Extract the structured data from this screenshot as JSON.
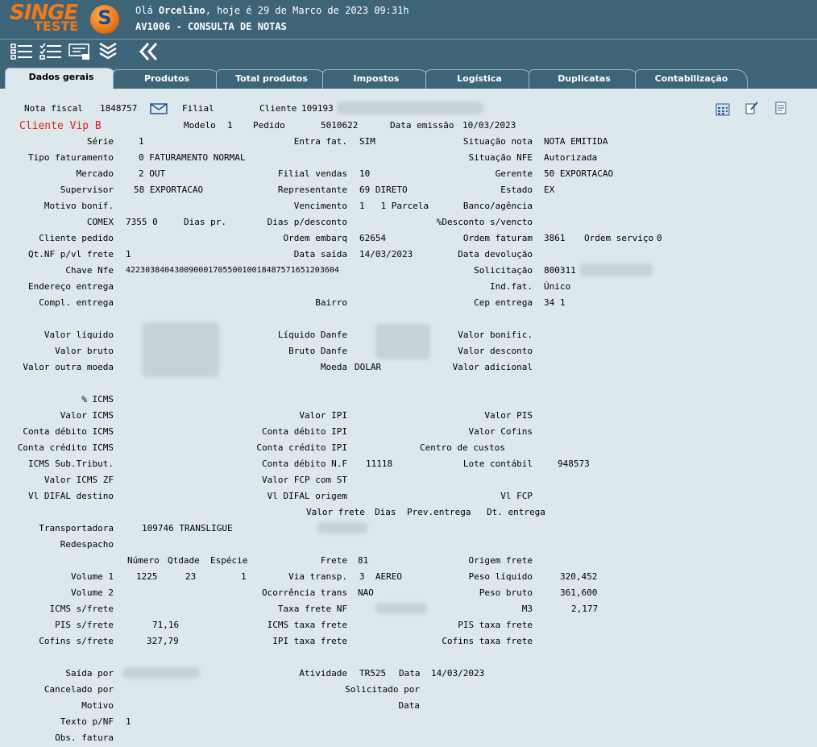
{
  "header": {
    "logo_main": "SINGE",
    "logo_sub": "TESTE",
    "greeting_prefix": "Olá",
    "user": "Orcelino",
    "greeting_suffix": ", hoje é 29 de Marco de 2023 09:31h",
    "screen_title": "AV1006 - CONSULTA DE NOTAS"
  },
  "tabs": [
    "Dados gerais",
    "Produtos",
    "Total produtos",
    "Impostos",
    "Logística",
    "Duplicatas",
    "Contabilização"
  ],
  "colors": {
    "header_bg": "#3e6478",
    "content_bg": "#dce8ec",
    "vip_text": "#e0201a",
    "logo_orange": "#f07a1a"
  },
  "labels": {
    "nota_fiscal": "Nota fiscal",
    "filial": "Filial",
    "cliente": "Cliente",
    "modelo": "Modelo",
    "pedido": "Pedido",
    "data_emissao": "Data emissão",
    "serie": "Série",
    "entra_fat": "Entra fat.",
    "situacao_nota": "Situação nota",
    "tipo_faturamento": "Tipo faturamento",
    "situacao_nfe": "Situação NFE",
    "mercado": "Mercado",
    "filial_vendas": "Filial vendas",
    "gerente": "Gerente",
    "supervisor": "Supervisor",
    "representante": "Representante",
    "estado": "Estado",
    "motivo_bonif": "Motivo bonif.",
    "vencimento": "Vencimento",
    "banco_agencia": "Banco/agência",
    "comex": "COMEX",
    "dias_pr": "Dias pr.",
    "dias_p_desconto": "Dias p/desconto",
    "desconto_s_vencto": "%Desconto s/vencto",
    "cliente_pedido": "Cliente pedido",
    "ordem_embarq": "Ordem embarq",
    "ordem_faturam": "Ordem faturam",
    "ordem_servico": "Ordem serviço",
    "qt_nf": "Qt.NF p/vl frete",
    "data_saida": "Data saída",
    "data_devolucao": "Data devolução",
    "chave_nfe": "Chave Nfe",
    "solicitacao": "Solicitação",
    "endereco_entrega": "Endereço entrega",
    "ind_fat": "Ind.fat.",
    "compl_entrega": "Compl. entrega",
    "bairro": "Bairro",
    "cep_entrega": "Cep entrega",
    "valor_liquido": "Valor líquido",
    "liquido_danfe": "Líquido Danfe",
    "valor_bonific": "Valor bonific.",
    "valor_bruto": "Valor bruto",
    "bruto_danfe": "Bruto Danfe",
    "valor_desconto": "Valor desconto",
    "valor_outra_moeda": "Valor outra moeda",
    "moeda": "Moeda",
    "valor_adicional": "Valor adicional",
    "pct_icms": "% ICMS",
    "valor_icms": "Valor ICMS",
    "valor_ipi": "Valor IPI",
    "valor_pis": "Valor PIS",
    "conta_debito_icms": "Conta débito ICMS",
    "conta_debito_ipi": "Conta débito IPI",
    "valor_cofins": "Valor Cofins",
    "conta_credito_icms": "Conta crédito ICMS",
    "conta_credito_ipi": "Conta crédito IPI",
    "centro_custos": "Centro de custos",
    "icms_sub_tribut": "ICMS Sub.Tribut.",
    "conta_debito_nf": "Conta débito N.F",
    "lote_contabil": "Lote contábil",
    "valor_icms_zf": "Valor ICMS ZF",
    "valor_fcp_com_st": "Valor FCP com ST",
    "vl_difal_destino": "Vl DIFAL destino",
    "vl_difal_origem": "Vl DIFAL origem",
    "vl_fcp": "Vl FCP",
    "valor_frete": "Valor frete",
    "dias": "Dias",
    "prev_entrega": "Prev.entrega",
    "dt_entrega": "Dt. entrega",
    "transportadora": "Transportadora",
    "redespacho": "Redespacho",
    "numero": "Número",
    "qtdade": "Qtdade",
    "especie": "Espécie",
    "frete": "Frete",
    "origem_frete": "Origem frete",
    "volume1": "Volume 1",
    "via_transp": "Via transp.",
    "peso_liquido": "Peso líquido",
    "volume2": "Volume 2",
    "ocorrencia_trans": "Ocorrência trans",
    "peso_bruto": "Peso bruto",
    "icms_s_frete": "ICMS s/frete",
    "taxa_frete_nf": "Taxa frete NF",
    "m3": "M3",
    "pis_s_frete": "PIS s/frete",
    "icms_taxa_frete": "ICMS taxa frete",
    "pis_taxa_frete": "PIS taxa frete",
    "cofins_s_frete": "Cofins s/frete",
    "ipi_taxa_frete": "IPI taxa frete",
    "cofins_taxa_frete": "Cofins taxa frete",
    "saida_por": "Saída por",
    "atividade": "Atividade",
    "data": "Data",
    "cancelado_por": "Cancelado por",
    "solicitado_por": "Solicitado por",
    "motivo": "Motivo",
    "data2": "Data",
    "texto_p_nf": "Texto p/NF",
    "obs_fatura": "Obs. fatura"
  },
  "values": {
    "nota_fiscal": "1848757",
    "cliente": "109193",
    "vip": "Cliente Vip B",
    "modelo": "1",
    "pedido": "5010622",
    "data_emissao": "10/03/2023",
    "serie": "1",
    "entra_fat": "SIM",
    "situacao_nota": "NOTA EMITIDA",
    "tipo_faturamento": "0 FATURAMENTO NORMAL",
    "situacao_nfe": "Autorizada",
    "mercado": "2 OUT",
    "filial_vendas": "10",
    "gerente": "50 EXPORTACAO",
    "supervisor": "58 EXPORTACAO",
    "representante": "69  DIRETO",
    "estado": "EX",
    "vencimento": "1   1 Parcela",
    "comex": "7355 0",
    "ordem_embarq": "62654",
    "ordem_faturam": "3861",
    "ordem_servico": "0",
    "qt_nf": "1",
    "data_saida": "14/03/2023",
    "chave_nfe": "42230384043009000170550010018487571651203604",
    "solicitacao": "800311",
    "ind_fat": "Único",
    "cep_entrega": "34 1",
    "moeda": "DOLAR",
    "conta_debito_nf": "11118",
    "lote_contabil": "948573",
    "transportadora": "109746 TRANSLIGUE",
    "frete": "81",
    "vol1_numero": "1225",
    "vol1_qtdade": "23",
    "vol1_especie": "1",
    "via_transp": "3  AEREO",
    "peso_liquido": "320,452",
    "ocorrencia_trans": "NAO",
    "peso_bruto": "361,600",
    "m3": "2,177",
    "pis_s_frete": "71,16",
    "cofins_s_frete": "327,79",
    "atividade": "TR525",
    "data": "14/03/2023",
    "texto_p_nf": "1"
  }
}
